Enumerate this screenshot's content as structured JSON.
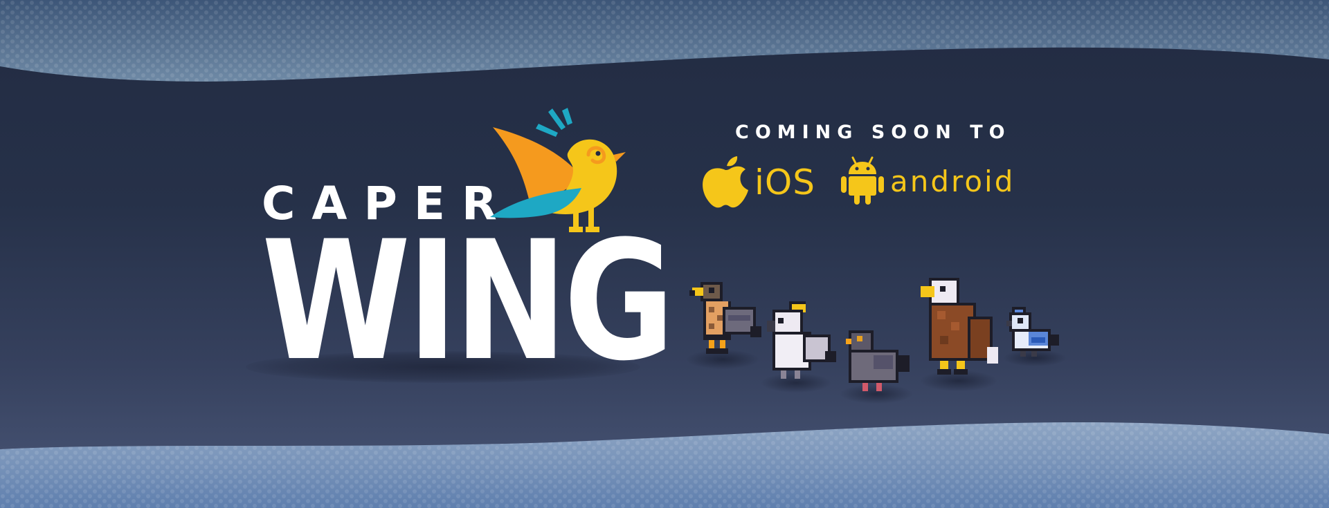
{
  "logo": {
    "line1": "CAPER",
    "line2": "WING",
    "bird_icon": "stylized-yellow-bird-logo-icon"
  },
  "availability": {
    "heading": "COMING SOON TO",
    "platforms": [
      {
        "name": "iOS",
        "icon": "apple-icon"
      },
      {
        "name": "android",
        "icon": "android-icon"
      }
    ]
  },
  "characters": [
    {
      "icon": "hawk-icon"
    },
    {
      "icon": "cockatoo-icon"
    },
    {
      "icon": "pigeon-icon"
    },
    {
      "icon": "bald-eagle-icon"
    },
    {
      "icon": "blue-jay-icon"
    }
  ],
  "colors": {
    "background": "#26304a",
    "accent_yellow": "#f5c61a",
    "text_white": "#ffffff",
    "teal": "#1ea8c4",
    "orange": "#f59a1e"
  }
}
